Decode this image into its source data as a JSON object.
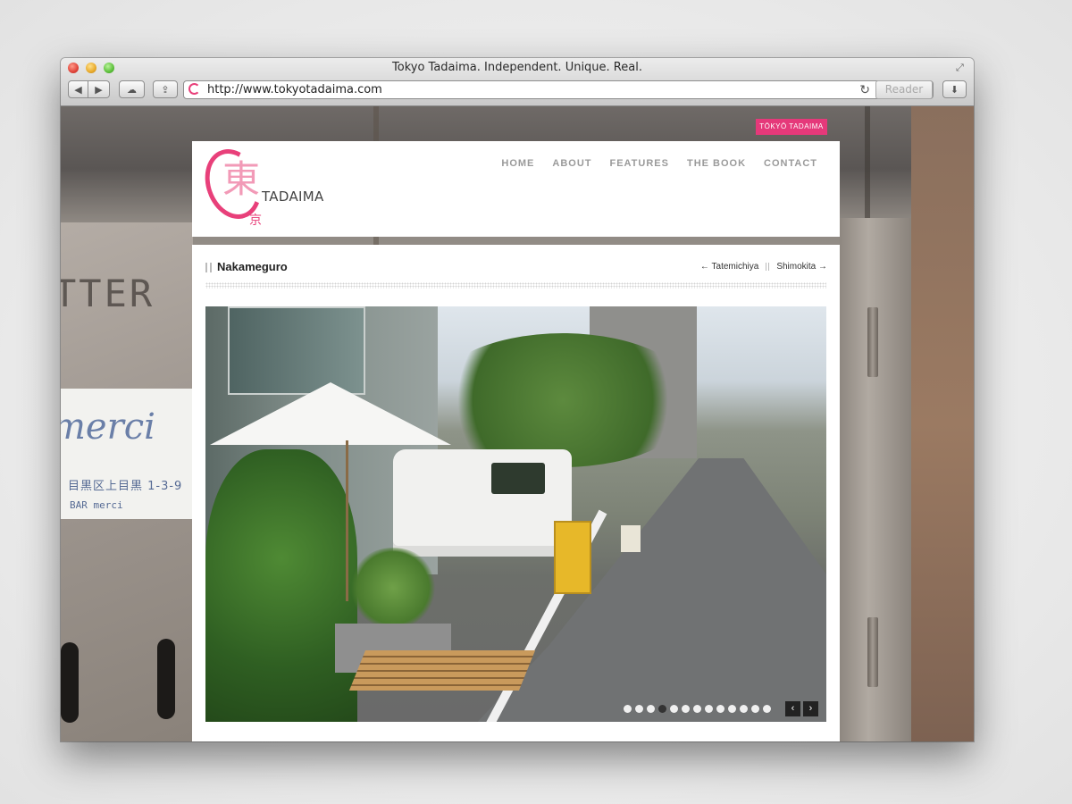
{
  "window": {
    "title": "Tokyo Tadaima. Independent. Unique. Real.",
    "url": "http://www.tokyotadaima.com",
    "reader_label": "Reader"
  },
  "site": {
    "tag": "TŌKYŌ TADAIMA",
    "logo_kanji": "東",
    "logo_kanji_small": "京",
    "logo_word": "TADAIMA",
    "nav": [
      "HOME",
      "ABOUT",
      "FEATURES",
      "THE BOOK",
      "CONTACT"
    ],
    "post_title": "Nakameguro",
    "prev_label": "← Tatemichiya",
    "next_label": "Shimokita →",
    "slider_dot_count": 13,
    "slider_active_index": 3,
    "slider_prev": "‹",
    "slider_next": "›"
  },
  "background": {
    "sign_big": "merci",
    "sign_line1": "目黒区上目黒 1-3-9",
    "sign_line2": "BAR merci",
    "wall_text": "TTER"
  },
  "colors": {
    "accent": "#e5397a"
  }
}
